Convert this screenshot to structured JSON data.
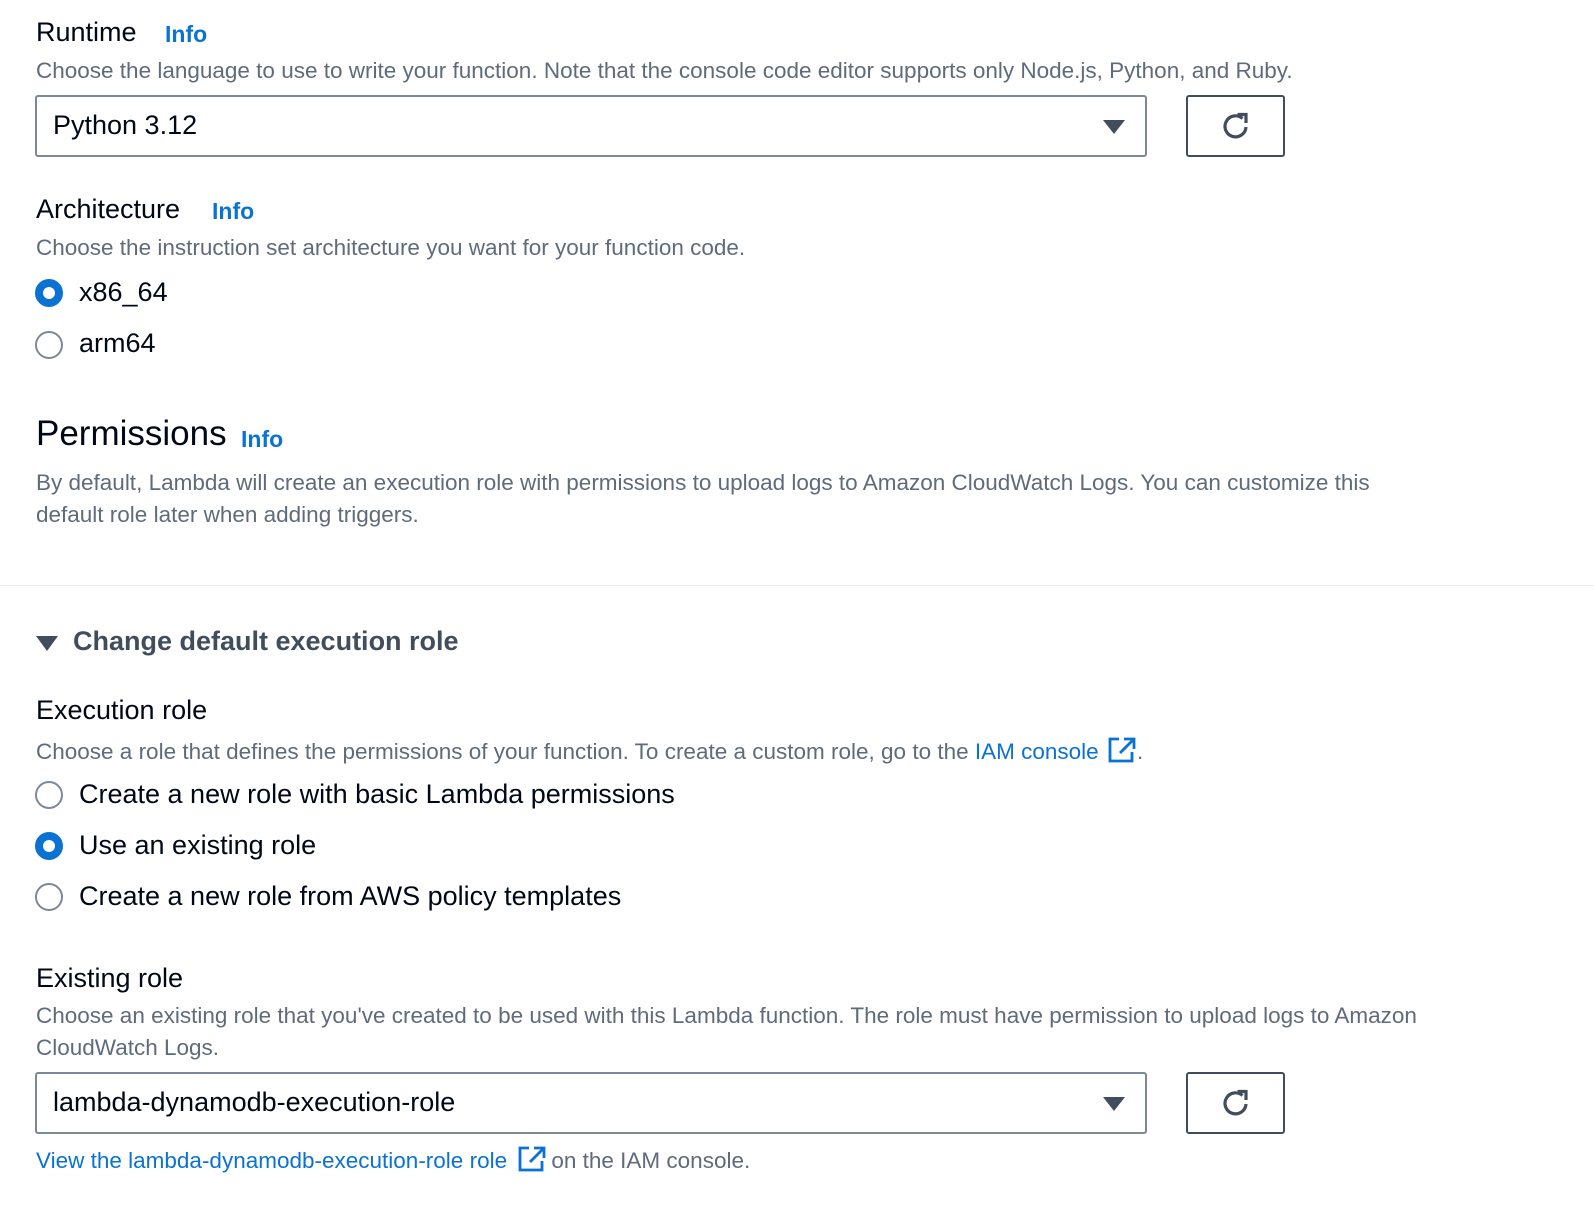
{
  "runtime": {
    "label": "Runtime",
    "info": "Info",
    "description": "Choose the language to use to write your function. Note that the console code editor supports only Node.js, Python, and Ruby.",
    "selected": "Python 3.12",
    "refresh_icon": "refresh-icon"
  },
  "architecture": {
    "label": "Architecture",
    "info": "Info",
    "description": "Choose the instruction set architecture you want for your function code.",
    "options": [
      {
        "label": "x86_64",
        "checked": true
      },
      {
        "label": "arm64",
        "checked": false
      }
    ]
  },
  "permissions": {
    "title": "Permissions",
    "info": "Info",
    "description_line1": "By default, Lambda will create an execution role with permissions to upload logs to Amazon CloudWatch Logs. You can customize this",
    "description_line2": "default role later when adding triggers."
  },
  "expander": {
    "label": "Change default execution role",
    "expanded": true
  },
  "execution_role": {
    "label": "Execution role",
    "description_prefix": "Choose a role that defines the permissions of your function. To create a custom role, go to the",
    "iam_link": "IAM console",
    "description_suffix": ".",
    "options": [
      {
        "label": "Create a new role with basic Lambda permissions",
        "checked": false
      },
      {
        "label": "Use an existing role",
        "checked": true
      },
      {
        "label": "Create a new role from AWS policy templates",
        "checked": false
      }
    ]
  },
  "existing_role": {
    "label": "Existing role",
    "description_line1": "Choose an existing role that you've created to be used with this Lambda function. The role must have permission to upload logs to Amazon",
    "description_line2": "CloudWatch Logs.",
    "selected": "lambda-dynamodb-execution-role",
    "view_link": "View the lambda-dynamodb-execution-role role",
    "view_suffix": "on the IAM console."
  },
  "colors": {
    "link": "#0972d3",
    "text": "#000716",
    "muted": "#5f6b7a",
    "border": "#7d8998"
  }
}
